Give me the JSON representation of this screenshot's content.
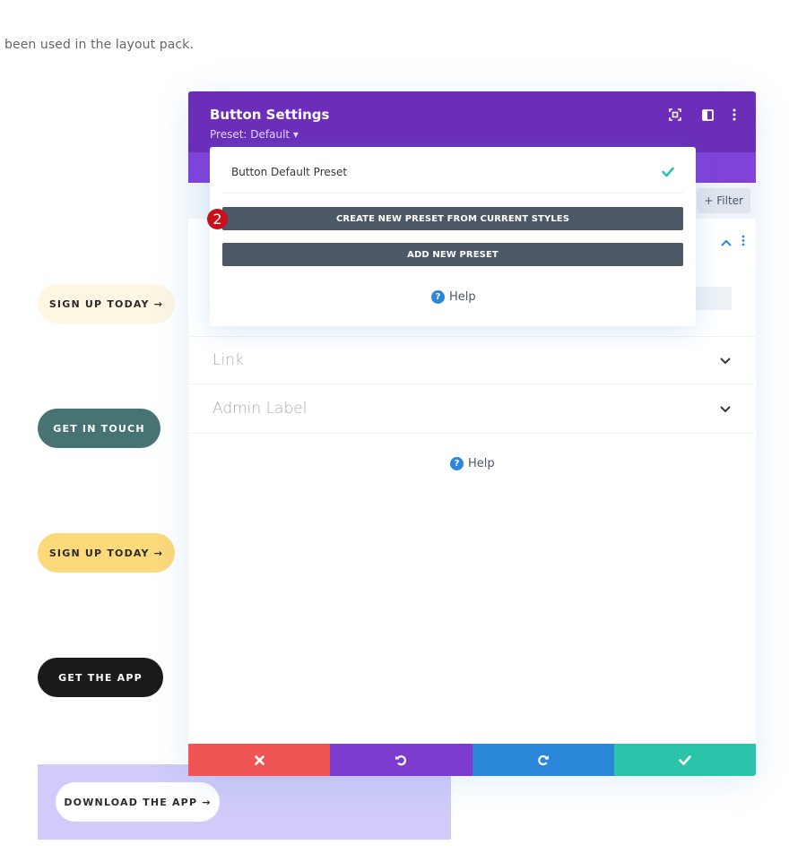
{
  "page": {
    "intro_text": "been used in the layout pack."
  },
  "demo_buttons": [
    {
      "label": "SIGN UP TODAY →",
      "bg": "#fdf6e3"
    },
    {
      "label": "GET IN TOUCH",
      "bg": "#477373"
    },
    {
      "label": "SIGN UP TODAY →",
      "bg": "#fcd97b"
    },
    {
      "label": "GET THE APP",
      "bg": "#1a1a1a"
    },
    {
      "label": "DOWNLOAD THE APP →",
      "bg": "#ffffff"
    }
  ],
  "modal": {
    "title": "Button Settings",
    "preset_label": "Preset: Default ▾",
    "header_icons": [
      "focus-icon",
      "split-view-icon",
      "more-vertical-icon"
    ],
    "filter_label": "+ Filter",
    "sections": [
      {
        "title": "Link"
      },
      {
        "title": "Admin Label"
      }
    ],
    "help_label": "Help",
    "footer": {
      "cancel": "cancel-icon",
      "undo": "undo-icon",
      "redo": "redo-icon",
      "save": "check-icon"
    },
    "colors": {
      "header": "#6c2eb9",
      "tabs": "#8142d8",
      "cancel": "#ef5555",
      "undo": "#7e3bd0",
      "redo": "#2b87da",
      "save": "#29c4a9"
    }
  },
  "preset_dropdown": {
    "items": [
      {
        "label": "Button Default Preset",
        "selected": true
      }
    ],
    "create_button": "CREATE NEW PRESET FROM CURRENT STYLES",
    "add_button": "ADD NEW PRESET",
    "help_label": "Help"
  },
  "annotation": {
    "step_number": "2"
  }
}
